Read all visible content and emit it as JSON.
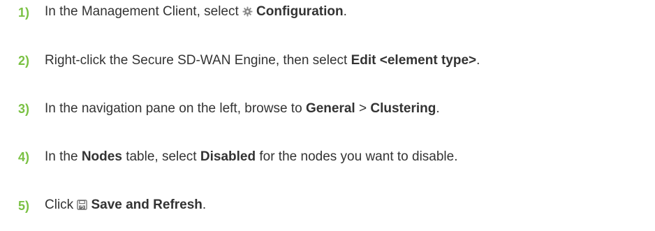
{
  "steps": [
    {
      "number": "1)",
      "parts": {
        "pre": "In the Management Client, select",
        "icon": "gear-icon",
        "target": "Configuration",
        "post": "."
      }
    },
    {
      "number": "2)",
      "parts": {
        "pre": "Right-click the Secure SD-WAN Engine, then select",
        "target": "Edit <element type>",
        "post": "."
      }
    },
    {
      "number": "3)",
      "parts": {
        "pre": "In the navigation pane on the left, browse to",
        "target1": "General",
        "sep": ">",
        "target2": "Clustering",
        "post": "."
      }
    },
    {
      "number": "4)",
      "parts": {
        "pre": "In the",
        "target1": "Nodes",
        "mid": "table, select",
        "target2": "Disabled",
        "post": "for the nodes you want to disable."
      }
    },
    {
      "number": "5)",
      "parts": {
        "pre": "Click",
        "icon": "save-refresh-icon",
        "target": "Save and Refresh",
        "post": "."
      }
    }
  ],
  "colors": {
    "step_number": "#7ac143",
    "text": "#333333"
  }
}
